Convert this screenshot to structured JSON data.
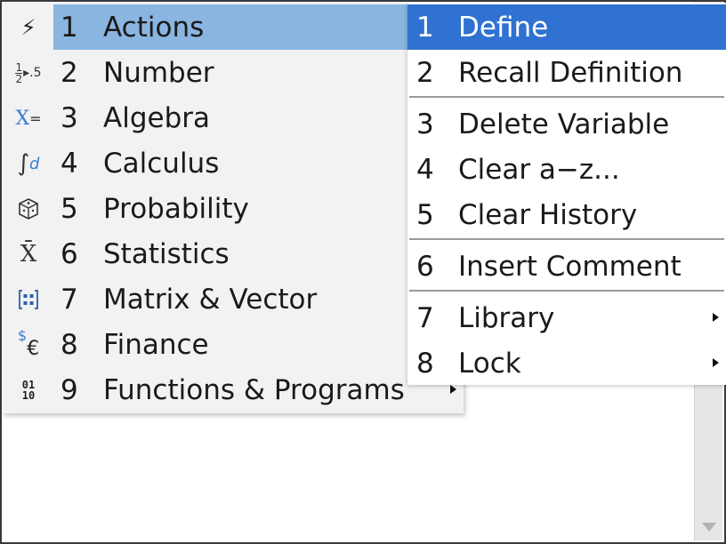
{
  "main_menu": {
    "items": [
      {
        "num": "1",
        "label": "Actions",
        "icon": "lightning-icon"
      },
      {
        "num": "2",
        "label": "Number",
        "icon": "fraction-decimal-icon"
      },
      {
        "num": "3",
        "label": "Algebra",
        "icon": "x-equals-icon"
      },
      {
        "num": "4",
        "label": "Calculus",
        "icon": "integral-derivative-icon"
      },
      {
        "num": "5",
        "label": "Probability",
        "icon": "dice-icon"
      },
      {
        "num": "6",
        "label": "Statistics",
        "icon": "x-bar-icon"
      },
      {
        "num": "7",
        "label": "Matrix & Vector",
        "icon": "matrix-icon"
      },
      {
        "num": "8",
        "label": "Finance",
        "icon": "currency-icon"
      },
      {
        "num": "9",
        "label": "Functions & Programs",
        "icon": "binary-program-icon"
      }
    ],
    "selected_index": 0
  },
  "sub_menu": {
    "items": [
      {
        "num": "1",
        "label": "Define"
      },
      {
        "num": "2",
        "label": "Recall Definition"
      },
      {
        "num": "3",
        "label": "Delete Variable"
      },
      {
        "num": "4",
        "label": "Clear a−z..."
      },
      {
        "num": "5",
        "label": "Clear History"
      },
      {
        "num": "6",
        "label": "Insert Comment"
      },
      {
        "num": "7",
        "label": "Library"
      },
      {
        "num": "8",
        "label": "Lock"
      }
    ],
    "selected_index": 0
  },
  "glyphs": {
    "lightning": "⚡",
    "frac_top": "1",
    "frac_bottom": "2",
    "dec": "▸.5",
    "x_eq_x": "X",
    "x_eq_eq": "=",
    "integral": "∫",
    "deriv": "d",
    "dice": "⬡",
    "xbar": "X̄",
    "matrix": "☷",
    "dollar": "$",
    "euro": "€",
    "bin_top": "01",
    "bin_bottom": "10"
  },
  "colors": {
    "main_highlight": "#8ab5e0",
    "sub_highlight": "#2f72d1",
    "menu_bg": "#f2f2f2"
  }
}
